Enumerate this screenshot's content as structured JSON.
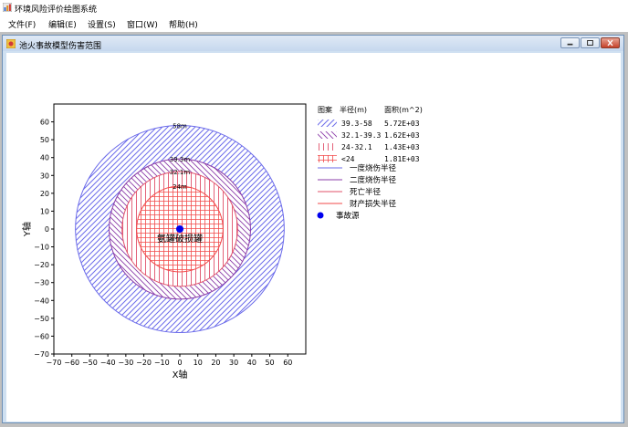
{
  "app": {
    "title": "环境风险评价绘图系统"
  },
  "menu": {
    "items": [
      {
        "label": "文件(F)"
      },
      {
        "label": "编辑(E)"
      },
      {
        "label": "设置(S)"
      },
      {
        "label": "窗口(W)"
      },
      {
        "label": "帮助(H)"
      }
    ]
  },
  "child_window": {
    "title": "池火事故模型伤害范围"
  },
  "colors": {
    "outer_ring": "#6b6bea",
    "second_ring": "#8a3ca8",
    "third_ring": "#e0506a",
    "inner_ring": "#f24a4a",
    "source_point": "#0000ee"
  },
  "chart_data": {
    "type": "concentric-circles",
    "xlabel": "X轴",
    "ylabel": "Y轴",
    "xlim": [
      -70,
      70
    ],
    "ylim": [
      -70,
      70
    ],
    "x_ticks": [
      -70,
      -60,
      -50,
      -40,
      -30,
      -20,
      -10,
      0,
      10,
      20,
      30,
      40,
      50,
      60
    ],
    "y_ticks": [
      -70,
      -60,
      -50,
      -40,
      -30,
      -20,
      -10,
      0,
      10,
      20,
      30,
      40,
      50,
      60
    ],
    "circles": [
      {
        "radius": 58,
        "label": "58m",
        "color": "#6b6bea",
        "fill": "diag-blue"
      },
      {
        "radius": 39.3,
        "label": "39.3m",
        "color": "#8a3ca8",
        "fill": "diag-purple"
      },
      {
        "radius": 32.1,
        "label": "32.1m",
        "color": "#e0506a",
        "fill": "vert-red"
      },
      {
        "radius": 24,
        "label": "24m",
        "color": "#f24a4a",
        "fill": "grid-red"
      }
    ],
    "source": {
      "x": 0,
      "y": 0,
      "label": "氨罐破损罐"
    },
    "legend": {
      "placement": "right",
      "headers": [
        "图案",
        "半径(m)",
        "面积(m^2)"
      ],
      "area_rows": [
        {
          "pattern": "diag-blue",
          "range": "39.3-58",
          "area": "5.72E+03"
        },
        {
          "pattern": "diag-purple",
          "range": "32.1-39.3",
          "area": "1.62E+03"
        },
        {
          "pattern": "vert-red",
          "range": "24-32.1",
          "area": "1.43E+03"
        },
        {
          "pattern": "grid-red",
          "range": "<24",
          "area": "1.81E+03"
        }
      ],
      "line_rows": [
        {
          "label": "一度烧伤半径",
          "color": "#6b6bea"
        },
        {
          "label": "二度烧伤半径",
          "color": "#8a3ca8"
        },
        {
          "label": "死亡半径",
          "color": "#e0506a"
        },
        {
          "label": "财产损失半径",
          "color": "#f24a4a"
        }
      ],
      "point_row": {
        "label": "事故源",
        "color": "#0000ee"
      }
    }
  }
}
